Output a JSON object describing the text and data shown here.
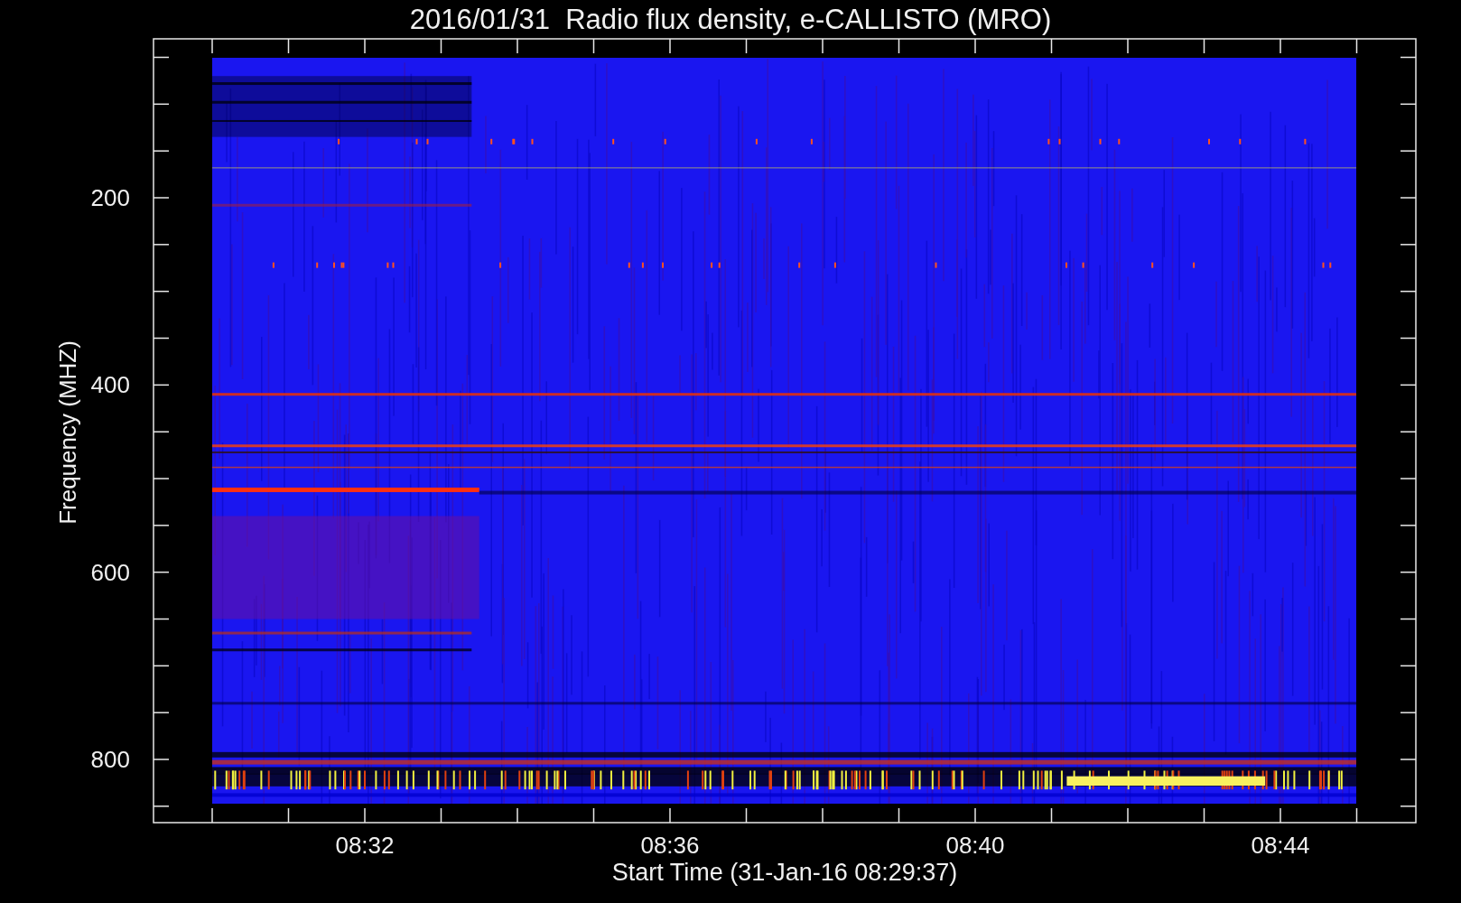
{
  "title": "2016/01/31  Radio flux density, e-CALLISTO (MRO)",
  "y_axis": {
    "label": "Frequency (MHZ)",
    "ticks": [
      "200",
      "400",
      "600",
      "800"
    ]
  },
  "x_axis": {
    "label": "Start Time (31-Jan-16 08:29:37)",
    "ticks": [
      "08:32",
      "08:36",
      "08:40",
      "08:44"
    ]
  }
}
